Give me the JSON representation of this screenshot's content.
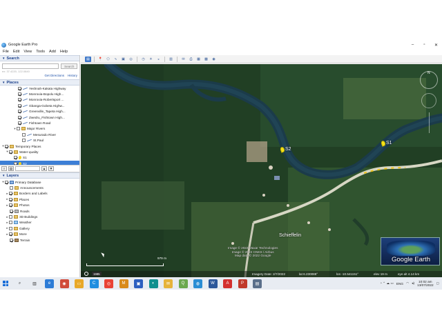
{
  "window": {
    "title": "Google Earth Pro",
    "controls": {
      "minimize": "–",
      "maximize": "▫",
      "close": "✕"
    }
  },
  "menu": [
    "File",
    "Edit",
    "View",
    "Tools",
    "Add",
    "Help"
  ],
  "search": {
    "header": "Search",
    "placeholder": "",
    "button": "Search",
    "hint": "ex: 37.4220, 122.0840",
    "get_directions": "Get Directions",
    "history": "History"
  },
  "places": {
    "header": "Places",
    "items": [
      {
        "label": "Yeshnah-Kakata Highway",
        "checked": true,
        "type": "path"
      },
      {
        "label": "Monrovia-Bopolu High...",
        "checked": true,
        "type": "path"
      },
      {
        "label": "Monrovia-Robertsport ...",
        "checked": true,
        "type": "path"
      },
      {
        "label": "Gbanga-Gobeta Highw...",
        "checked": true,
        "type": "path"
      },
      {
        "label": "Greenville_Tapeta High...",
        "checked": true,
        "type": "path"
      },
      {
        "label": "Zwedru_Fishtown High...",
        "checked": true,
        "type": "path"
      },
      {
        "label": "Fishtown Road",
        "checked": true,
        "type": "path"
      },
      {
        "label": "Major Rivers",
        "checked": false,
        "type": "folder"
      },
      {
        "label": "Mesurado River",
        "checked": false,
        "type": "path"
      },
      {
        "label": "St.Paul",
        "checked": false,
        "type": "path"
      },
      {
        "label": "Temporary Places",
        "checked": true,
        "type": "folder"
      },
      {
        "label": "Water-quality",
        "checked": true,
        "type": "folder"
      },
      {
        "label": "S1",
        "checked": true,
        "type": "pin"
      },
      {
        "label": "S2",
        "checked": true,
        "type": "pin",
        "selected": true
      }
    ]
  },
  "layers": {
    "header": "Layers",
    "items": [
      {
        "label": "Primary Database",
        "checked": true
      },
      {
        "label": "Announcements",
        "checked": false
      },
      {
        "label": "Borders and Labels",
        "checked": true
      },
      {
        "label": "Places",
        "checked": true
      },
      {
        "label": "Photos",
        "checked": true
      },
      {
        "label": "Roads",
        "checked": true
      },
      {
        "label": "3D Buildings",
        "checked": false
      },
      {
        "label": "Weather",
        "checked": false
      },
      {
        "label": "Gallery",
        "checked": false
      },
      {
        "label": "More",
        "checked": true
      },
      {
        "label": "Terrain",
        "checked": true
      }
    ]
  },
  "map": {
    "markers": [
      {
        "label": "S1"
      },
      {
        "label": "S2"
      }
    ],
    "place_label": "Schieffelin",
    "credits": [
      "Image © 2022 Maxar Technologies",
      "Image © 2022 CNES / Airbus",
      "Map data © 2022 Google"
    ],
    "scale_label": "979 m",
    "history_year": "1985",
    "logo": "Google Earth",
    "status": {
      "imagery_date": "Imagery Date: 2/7/2022",
      "lat": "lat  6.230088°",
      "lon": "lon  -10.541151°",
      "elev": "elev  19 m",
      "eye_alt": "eye alt  4.14 km"
    },
    "colors": {
      "water": "#1c3a4a",
      "forest": "#214326",
      "road": "#d7d7c4"
    }
  },
  "taskbar": {
    "tray": {
      "lang": "ENG",
      "time": "10:02 am",
      "date": "13/07/2022"
    }
  }
}
